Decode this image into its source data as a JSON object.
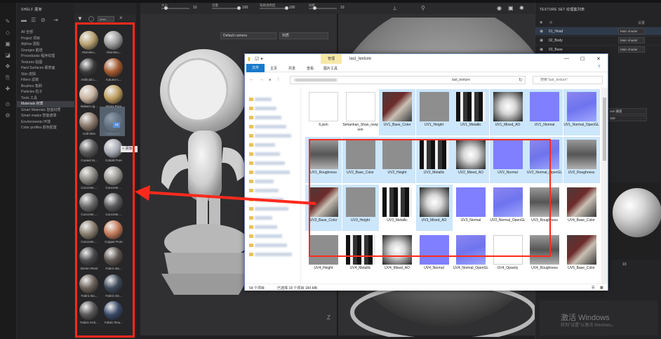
{
  "app": {
    "shelf_title": "SHELF 展架",
    "viewport_camera": "Default camera",
    "viewport_mode": "材质",
    "right_header": "TEXTURE SET 纹理集列表",
    "right_settings": "设置"
  },
  "viewport_toolbar": {
    "size_label": "大小",
    "size_value": "10",
    "flow_label": "流量",
    "flow_value": "100",
    "opacity_label": "笔刷透明度",
    "opacity_value": "100",
    "spacing_label": "间距",
    "spacing_value": "10"
  },
  "shelf": {
    "items": [
      {
        "label": "All 全部",
        "active": false
      },
      {
        "label": "Project 项目",
        "active": false
      },
      {
        "label": "Alphas 透贴",
        "active": false
      },
      {
        "label": "Grunges 脏迹",
        "active": false
      },
      {
        "label": "Procedurals 程序纹理",
        "active": false
      },
      {
        "label": "Textures 贴图",
        "active": false
      },
      {
        "label": "Hard Surfaces 硬表面",
        "active": false
      },
      {
        "label": "Skin 皮肤",
        "active": false
      },
      {
        "label": "Filters 滤镜",
        "active": false
      },
      {
        "label": "Brushes 笔刷",
        "active": false
      },
      {
        "label": "Particles 粒子",
        "active": false
      },
      {
        "label": "Tools 工具",
        "active": false
      },
      {
        "label": "Materials 材质",
        "active": true
      },
      {
        "label": "Smart Materials 智能材质",
        "active": false
      },
      {
        "label": "Smart masks 智能遮罩",
        "active": false
      },
      {
        "label": "Environments 环境",
        "active": false
      },
      {
        "label": "Color profiles 颜色配置",
        "active": false
      }
    ]
  },
  "materials": {
    "search_value": "Mate...",
    "drag_badge": "18",
    "drag_tag": "+ 添加",
    "items": [
      {
        "label": "Aluminiu...",
        "color": "#b8a070"
      },
      {
        "label": "Aluminiu...",
        "color": "#9b9b9b"
      },
      {
        "label": "Artificial L...",
        "color": "#3a3a3a"
      },
      {
        "label": "Autumn L...",
        "color": "#a45a30"
      },
      {
        "label": "Baked Lig...",
        "color": "#c9b4a0"
      },
      {
        "label": "Brass Pure",
        "color": "#c0a060"
      },
      {
        "label": "Calf Skin",
        "color": "#8c7a6c"
      },
      {
        "label": "Carbon Fi...",
        "color": "#5c6470"
      },
      {
        "label": "Coated M...",
        "color": "#5a5a5a"
      },
      {
        "label": "Cobalt Pure",
        "color": "#a8aab4"
      },
      {
        "label": "Concrete ...",
        "color": "#8c8a84"
      },
      {
        "label": "Concrete ...",
        "color": "#9a9894"
      },
      {
        "label": "Concrete ...",
        "color": "#6c6c6c"
      },
      {
        "label": "Concrete ...",
        "color": "#5a5a5c"
      },
      {
        "label": "Concrete ...",
        "color": "#8a8070"
      },
      {
        "label": "Copper Pure",
        "color": "#c47a58"
      },
      {
        "label": "Denim Rivet",
        "color": "#4a4a4c"
      },
      {
        "label": "Fabric Ba...",
        "color": "#5c5450"
      },
      {
        "label": "Fabric Ba...",
        "color": "#6c625a"
      },
      {
        "label": "Fabric De...",
        "color": "#3e4a5a"
      },
      {
        "label": "Fabric Knit...",
        "color": "#5a5858"
      },
      {
        "label": "Fabric Rou...",
        "color": "#3a4a68"
      }
    ]
  },
  "texture_sets": [
    {
      "name": "01_Head",
      "shader": "Main shader",
      "selected": true
    },
    {
      "name": "02_Body",
      "shader": "Main shader",
      "selected": false
    },
    {
      "name": "03_Base",
      "shader": "Main shader",
      "selected": false
    }
  ],
  "right_props": {
    "line1": "uvs 通道",
    "line2": "100"
  },
  "right_number": "10",
  "watermark": {
    "line1": "激活 Windows",
    "line2": "转到\"设置\"以激活 Windows。"
  },
  "explorer": {
    "title": "last_texture",
    "manage_tab": "管理",
    "ribbon": [
      "文件",
      "主页",
      "共享",
      "查看",
      "图片工具"
    ],
    "path": "last_texture",
    "search_placeholder": "搜索\"last_texture\"",
    "status_count": "54 个项目",
    "status_selected": "已选择 18 个项目 184 MB",
    "files": [
      {
        "name": "6.json",
        "kind": "doc",
        "sel": false
      },
      {
        "name": "Sehanhan_Shao_newjson",
        "kind": "doc",
        "sel": false
      },
      {
        "name": "UV1_Base_Color",
        "kind": "color",
        "sel": true
      },
      {
        "name": "UV1_Height",
        "kind": "gray",
        "sel": true
      },
      {
        "name": "UV1_Metallic",
        "kind": "mask",
        "sel": true
      },
      {
        "name": "UV1_Mixed_AO",
        "kind": "ao",
        "sel": true
      },
      {
        "name": "UV1_Normal",
        "kind": "normal",
        "sel": true
      },
      {
        "name": "UV1_Normal_OpenGL",
        "kind": "normal2",
        "sel": true
      },
      {
        "name": "UV1_Roughness",
        "kind": "rough",
        "sel": true
      },
      {
        "name": "UV2_Base_Color",
        "kind": "gray",
        "sel": true
      },
      {
        "name": "UV2_Height",
        "kind": "gray",
        "sel": true
      },
      {
        "name": "UV2_Metallic",
        "kind": "mask",
        "sel": true
      },
      {
        "name": "UV2_Mixed_AO",
        "kind": "ao",
        "sel": true
      },
      {
        "name": "UV2_Normal",
        "kind": "normal",
        "sel": true
      },
      {
        "name": "UV2_Normal_OpenGL",
        "kind": "normal2",
        "sel": true
      },
      {
        "name": "UV2_Roughness",
        "kind": "rough",
        "sel": true
      },
      {
        "name": "UV3_Base_Color",
        "kind": "color",
        "sel": true
      },
      {
        "name": "UV3_Height",
        "kind": "gray",
        "sel": true
      },
      {
        "name": "UV3_Metallic",
        "kind": "mask",
        "sel": false
      },
      {
        "name": "UV3_Mixed_AO",
        "kind": "ao",
        "sel": true
      },
      {
        "name": "UV3_Normal",
        "kind": "normal",
        "sel": false
      },
      {
        "name": "UV3_Normal_OpenGL",
        "kind": "normal2",
        "sel": false
      },
      {
        "name": "UV3_Roughness",
        "kind": "rough",
        "sel": false
      },
      {
        "name": "UV4_Base_Color",
        "kind": "color",
        "sel": false
      },
      {
        "name": "UV4_Height",
        "kind": "gray",
        "sel": false
      },
      {
        "name": "UV4_Metallic",
        "kind": "mask",
        "sel": false
      },
      {
        "name": "UV4_Mixed_AO",
        "kind": "ao",
        "sel": false
      },
      {
        "name": "UV4_Normal",
        "kind": "normal",
        "sel": false
      },
      {
        "name": "UV4_Normal_OpenGL",
        "kind": "normal2",
        "sel": false
      },
      {
        "name": "UV4_Opacity",
        "kind": "white",
        "sel": false
      },
      {
        "name": "UV4_Roughness",
        "kind": "rough",
        "sel": false
      },
      {
        "name": "UV5_Base_Color",
        "kind": "color",
        "sel": false
      }
    ]
  }
}
